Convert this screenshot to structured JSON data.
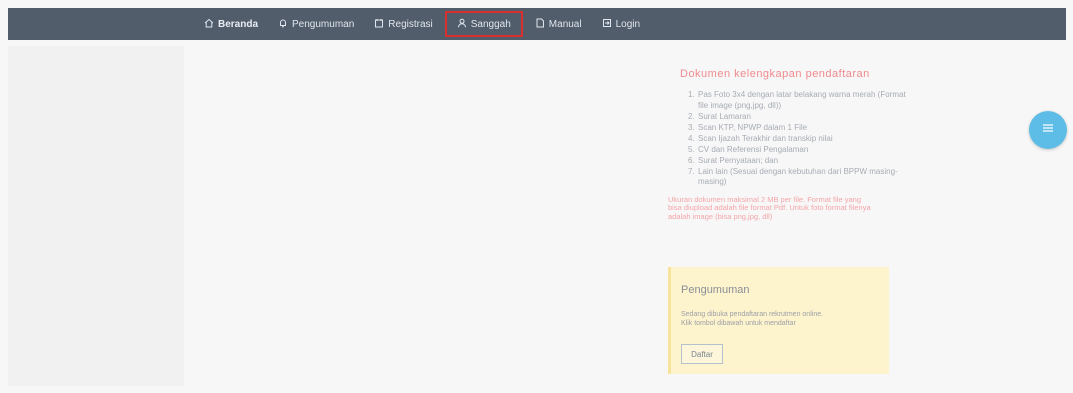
{
  "navbar": {
    "items": [
      {
        "label": "Beranda",
        "icon": "home-icon"
      },
      {
        "label": "Pengumuman",
        "icon": "bell-icon"
      },
      {
        "label": "Registrasi",
        "icon": "register-icon"
      },
      {
        "label": "Sanggah",
        "icon": "user-icon"
      },
      {
        "label": "Manual",
        "icon": "document-icon"
      },
      {
        "label": "Login",
        "icon": "login-icon"
      }
    ],
    "active": "Beranda",
    "highlighted": "Sanggah"
  },
  "documents": {
    "title": "Dokumen kelengkapan pendaftaran",
    "items": [
      {
        "num": "1.",
        "text": "Pas Foto 3x4 dengan latar belakang warna merah (Format file image (png,jpg, dll))"
      },
      {
        "num": "2.",
        "text": "Surat Lamaran"
      },
      {
        "num": "3.",
        "text": "Scan KTP, NPWP dalam 1 File"
      },
      {
        "num": "4.",
        "text": "Scan Ijazah Terakhir dan transkip nilai"
      },
      {
        "num": "5.",
        "text": "CV dan Referensi Pengalaman"
      },
      {
        "num": "6.",
        "text": "Surat Pernyataan; dan"
      },
      {
        "num": "7.",
        "text": "Lain lain (Sesuai dengan kebutuhan dari BPPW masing-masing)"
      }
    ],
    "note": "Ukuran dokumen maksimal 2 MB per file. Format file yang bisa diupload adalah file format Pdf. Untuk foto format filenya adalah image (bisa png,jpg, dll)"
  },
  "announcement": {
    "title": "Pengumuman",
    "line1": "Sedang dibuka pendaftaran rekrutmen online.",
    "line2": "Klik tombol dibawah untuk mendaftar",
    "button": "Daftar"
  },
  "colors": {
    "navbar": "#525d6b",
    "highlight_border": "#d9302f",
    "docs_title": "#f08a8e",
    "announce_bg": "#fdf3cd",
    "fab": "#5ebde6"
  },
  "fab": {
    "icon": "menu-icon"
  }
}
